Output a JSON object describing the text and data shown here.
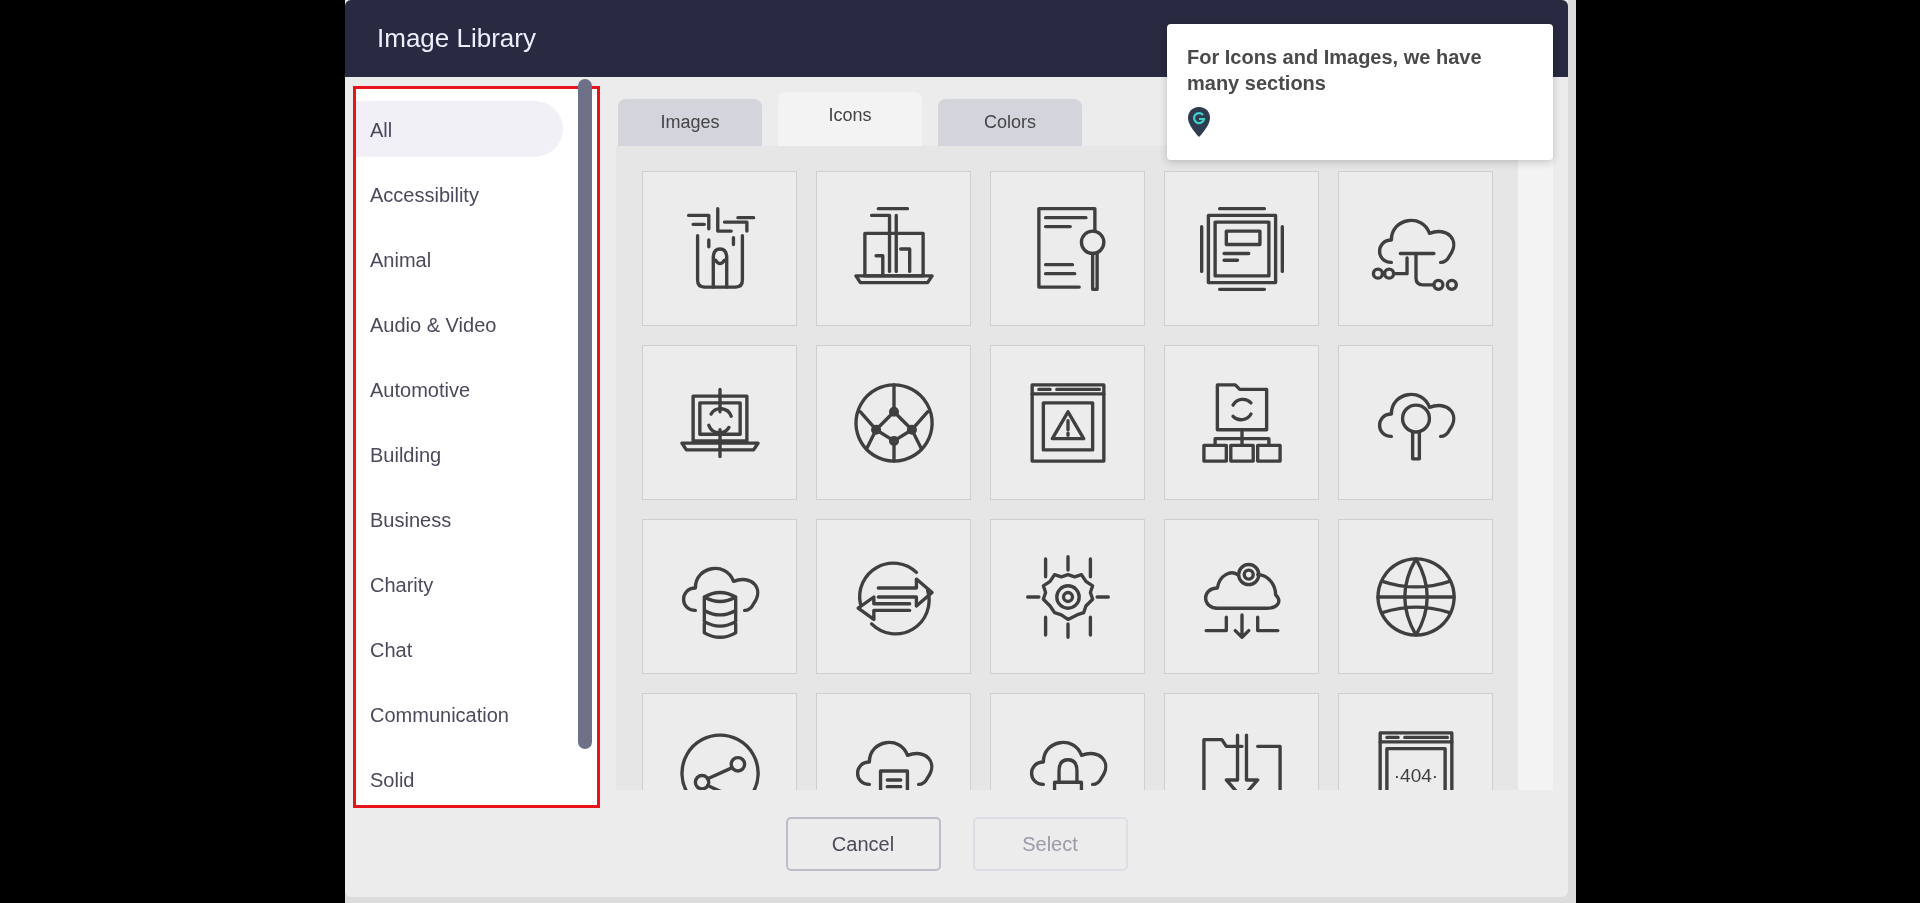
{
  "dialog": {
    "title": "Image Library"
  },
  "sidebar": {
    "highlighted": true,
    "items": [
      {
        "label": "All",
        "selected": true
      },
      {
        "label": "Accessibility",
        "selected": false
      },
      {
        "label": "Animal",
        "selected": false
      },
      {
        "label": "Audio & Video",
        "selected": false
      },
      {
        "label": "Automotive",
        "selected": false
      },
      {
        "label": "Building",
        "selected": false
      },
      {
        "label": "Business",
        "selected": false
      },
      {
        "label": "Charity",
        "selected": false
      },
      {
        "label": "Chat",
        "selected": false
      },
      {
        "label": "Communication",
        "selected": false
      },
      {
        "label": "Solid",
        "selected": false
      }
    ]
  },
  "tabs": [
    {
      "label": "Images",
      "selected": false
    },
    {
      "label": "Icons",
      "selected": true
    },
    {
      "label": "Colors",
      "selected": false
    }
  ],
  "icon_grid": [
    {
      "kind": "circuit-finger"
    },
    {
      "kind": "circuit-laptop"
    },
    {
      "kind": "document-search"
    },
    {
      "kind": "chip"
    },
    {
      "kind": "cloud-network"
    },
    {
      "kind": "laptop-sync"
    },
    {
      "kind": "node-sphere"
    },
    {
      "kind": "browser-warning"
    },
    {
      "kind": "folder-sync"
    },
    {
      "kind": "cloud-search"
    },
    {
      "kind": "cloud-database"
    },
    {
      "kind": "exchange-arrows"
    },
    {
      "kind": "gear-circuit"
    },
    {
      "kind": "cloud-gear"
    },
    {
      "kind": "globe"
    },
    {
      "kind": "share-circle"
    },
    {
      "kind": "cloud-phone"
    },
    {
      "kind": "cloud-lock"
    },
    {
      "kind": "folder-download"
    },
    {
      "kind": "browser-error",
      "label": "·404·"
    }
  ],
  "buttons": [
    {
      "label": "Cancel",
      "disabled": false
    },
    {
      "label": "Select",
      "disabled": true
    }
  ],
  "tooltip": {
    "text": "For Icons and Images, we have many sections"
  }
}
